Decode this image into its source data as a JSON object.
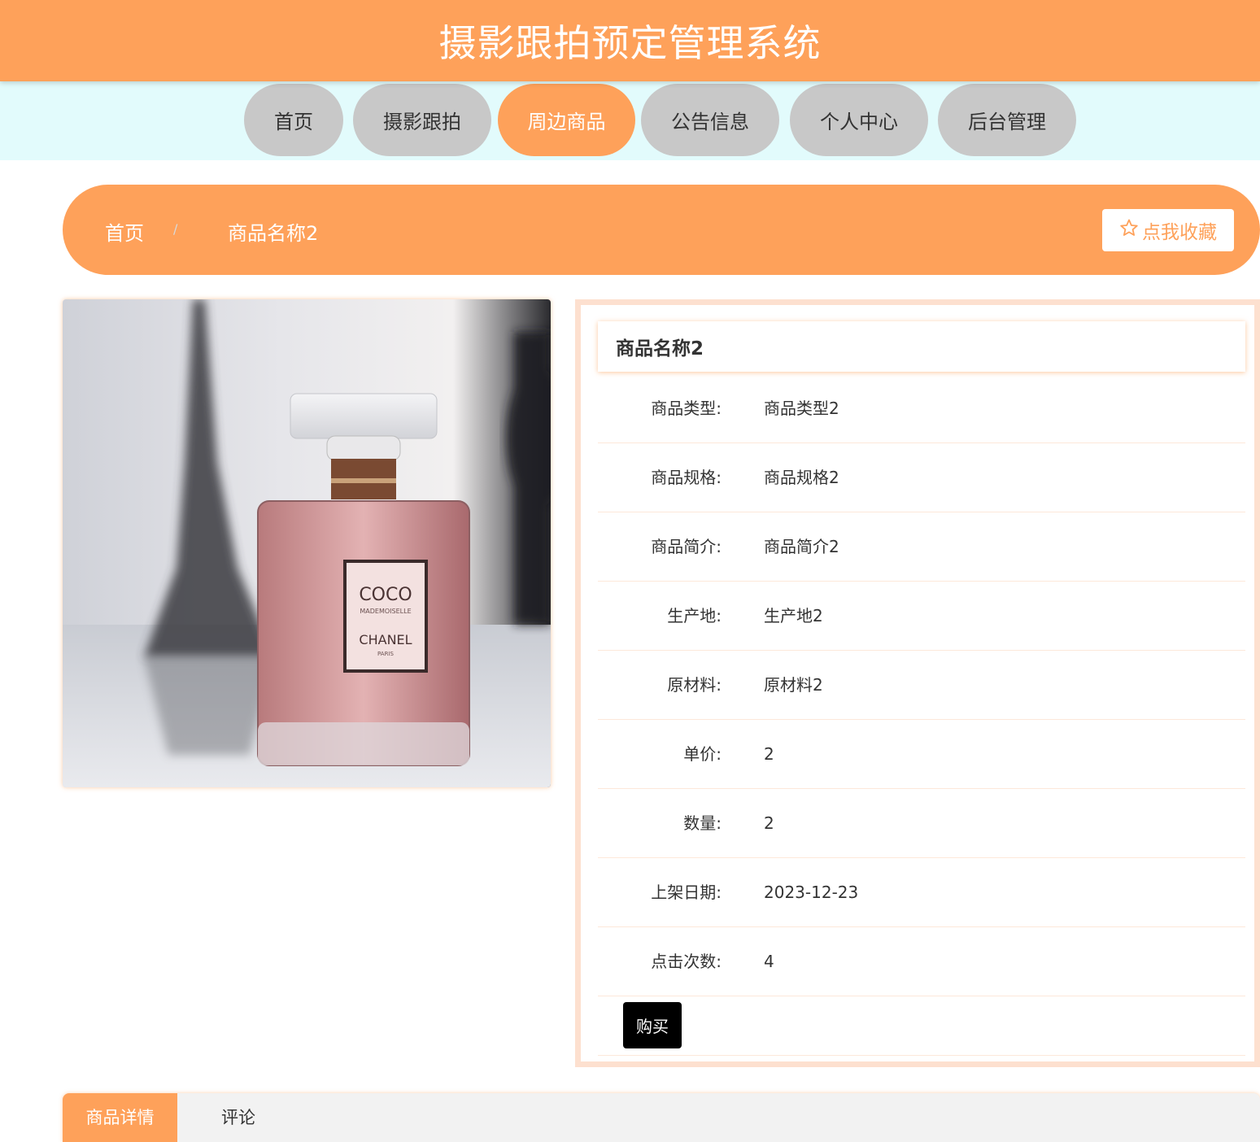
{
  "header": {
    "title": "摄影跟拍预定管理系统"
  },
  "nav": {
    "items": [
      {
        "label": "首页"
      },
      {
        "label": "摄影跟拍"
      },
      {
        "label": "周边商品"
      },
      {
        "label": "公告信息"
      },
      {
        "label": "个人中心"
      },
      {
        "label": "后台管理"
      }
    ],
    "active": "周边商品"
  },
  "breadcrumb": {
    "home": "首页",
    "separator": "/",
    "current": "商品名称2"
  },
  "favorite": {
    "label": "点我收藏",
    "icon": "star-outline-icon"
  },
  "product": {
    "name": "商品名称2",
    "fields": [
      {
        "label": "商品类型:",
        "value": "商品类型2"
      },
      {
        "label": "商品规格:",
        "value": "商品规格2"
      },
      {
        "label": "商品简介:",
        "value": "商品简介2"
      },
      {
        "label": "生产地:",
        "value": "生产地2"
      },
      {
        "label": "原材料:",
        "value": "原材料2"
      },
      {
        "label": "单价:",
        "value": "2"
      },
      {
        "label": "数量:",
        "value": "2"
      },
      {
        "label": "上架日期:",
        "value": "2023-12-23"
      },
      {
        "label": "点击次数:",
        "value": "4"
      }
    ],
    "buy_label": "购买",
    "image": {
      "label_line1": "COCO",
      "label_line2": "MADEMOISELLE",
      "label_line3": "CHANEL",
      "label_line4": "PARIS"
    }
  },
  "tabs": [
    {
      "label": "商品详情"
    },
    {
      "label": "评论"
    }
  ],
  "colors": {
    "accent": "#fea15a",
    "nav_bg": "#e2fbfc",
    "nav_pill": "#c8c8c8",
    "panel_border": "#fde0cf"
  }
}
